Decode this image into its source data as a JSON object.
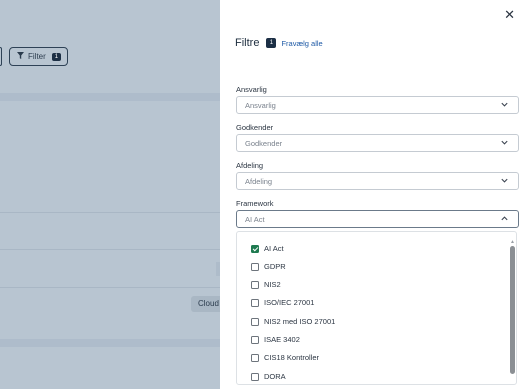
{
  "background": {
    "filter_button": {
      "label": "Filter",
      "count": "1"
    },
    "chip_text": "Cloud"
  },
  "panel": {
    "title": "Filtre",
    "active_count": "1",
    "clear_label": "Fravælg alle",
    "close_icon": "close-icon",
    "fields": [
      {
        "label": "Ansvarlig",
        "placeholder": "Ansvarlig"
      },
      {
        "label": "Godkender",
        "placeholder": "Godkender"
      },
      {
        "label": "Afdeling",
        "placeholder": "Afdeling"
      },
      {
        "label": "Framework",
        "value": "AI Act"
      }
    ],
    "framework_options": [
      {
        "label": "AI Act",
        "checked": true
      },
      {
        "label": "GDPR",
        "checked": false
      },
      {
        "label": "NIS2",
        "checked": false
      },
      {
        "label": "ISO/IEC 27001",
        "checked": false
      },
      {
        "label": "NIS2 med ISO 27001",
        "checked": false
      },
      {
        "label": "ISAE 3402",
        "checked": false
      },
      {
        "label": "CIS18 Kontroller",
        "checked": false
      },
      {
        "label": "DORA",
        "checked": false
      }
    ]
  },
  "colors": {
    "accent": "#1c2f45",
    "link": "#1e5aa6",
    "check": "#1f7a50",
    "overlay": "#b8c5d1"
  }
}
